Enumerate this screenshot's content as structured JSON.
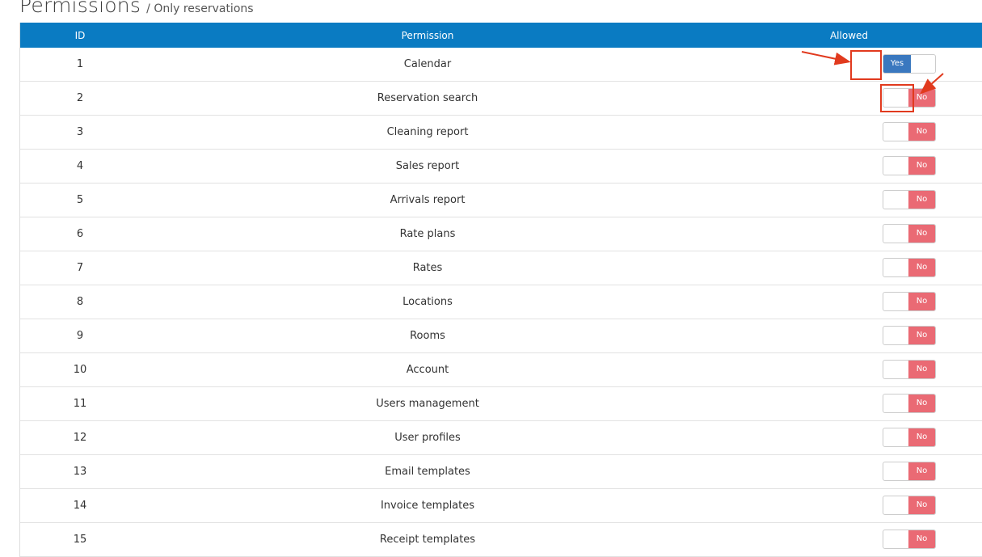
{
  "page": {
    "title": "Permissions",
    "subtitle": "/ Only reservations"
  },
  "table": {
    "headers": {
      "id": "ID",
      "permission": "Permission",
      "allowed": "Allowed"
    },
    "rows": [
      {
        "id": "1",
        "permission": "Calendar",
        "allowed": true,
        "label": "Yes"
      },
      {
        "id": "2",
        "permission": "Reservation search",
        "allowed": false,
        "label": "No"
      },
      {
        "id": "3",
        "permission": "Cleaning report",
        "allowed": false,
        "label": "No"
      },
      {
        "id": "4",
        "permission": "Sales report",
        "allowed": false,
        "label": "No"
      },
      {
        "id": "5",
        "permission": "Arrivals report",
        "allowed": false,
        "label": "No"
      },
      {
        "id": "6",
        "permission": "Rate plans",
        "allowed": false,
        "label": "No"
      },
      {
        "id": "7",
        "permission": "Rates",
        "allowed": false,
        "label": "No"
      },
      {
        "id": "8",
        "permission": "Locations",
        "allowed": false,
        "label": "No"
      },
      {
        "id": "9",
        "permission": "Rooms",
        "allowed": false,
        "label": "No"
      },
      {
        "id": "10",
        "permission": "Account",
        "allowed": false,
        "label": "No"
      },
      {
        "id": "11",
        "permission": "Users management",
        "allowed": false,
        "label": "No"
      },
      {
        "id": "12",
        "permission": "User profiles",
        "allowed": false,
        "label": "No"
      },
      {
        "id": "13",
        "permission": "Email templates",
        "allowed": false,
        "label": "No"
      },
      {
        "id": "14",
        "permission": "Invoice templates",
        "allowed": false,
        "label": "No"
      },
      {
        "id": "15",
        "permission": "Receipt templates",
        "allowed": false,
        "label": "No"
      }
    ]
  },
  "colors": {
    "header_bg": "#0a7bc2",
    "yes_bg": "#3a78bf",
    "no_bg": "#ea6a74",
    "annotation": "#e13a1e"
  }
}
